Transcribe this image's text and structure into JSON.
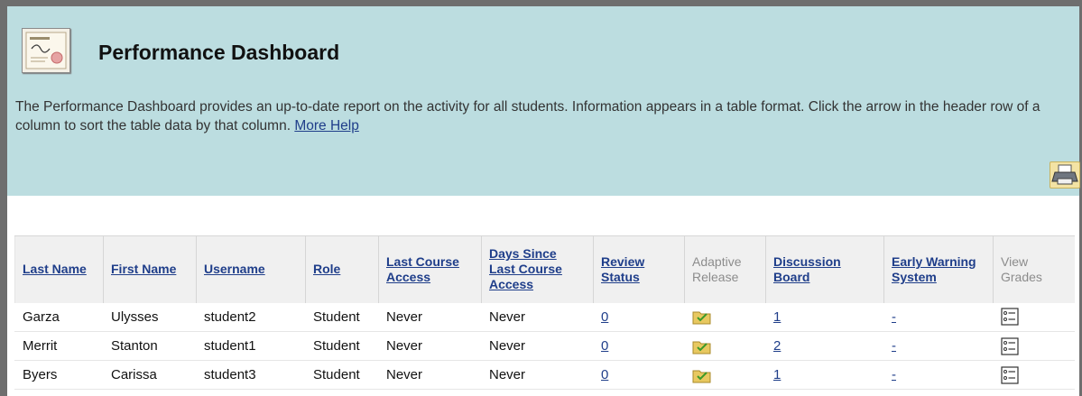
{
  "header": {
    "title": "Performance Dashboard",
    "description": "The Performance Dashboard provides an up-to-date report on the activity for all students. Information appears in a table format. Click the arrow in the header row of a column to sort the table data by that column.",
    "help_link": "More Help",
    "icon": "certificate-icon",
    "print_icon": "printer-icon"
  },
  "table": {
    "columns": [
      {
        "label": "Last Name",
        "sortable": true
      },
      {
        "label": "First Name",
        "sortable": true
      },
      {
        "label": "Username",
        "sortable": true
      },
      {
        "label": "Role",
        "sortable": true
      },
      {
        "label": "Last Course Access",
        "sortable": true
      },
      {
        "label": "Days Since Last Course Access",
        "sortable": true
      },
      {
        "label": "Review Status",
        "sortable": true
      },
      {
        "label": "Adaptive Release",
        "sortable": false
      },
      {
        "label": "Discussion Board",
        "sortable": true
      },
      {
        "label": "Early Warning System",
        "sortable": true
      },
      {
        "label": "View Grades",
        "sortable": false
      }
    ],
    "rows": [
      {
        "last": "Garza",
        "first": "Ulysses",
        "username": "student2",
        "role": "Student",
        "last_access": "Never",
        "days_since": "Never",
        "review": "0",
        "discussion": "1",
        "early_warning": "-"
      },
      {
        "last": "Merrit",
        "first": "Stanton",
        "username": "student1",
        "role": "Student",
        "last_access": "Never",
        "days_since": "Never",
        "review": "0",
        "discussion": "2",
        "early_warning": "-"
      },
      {
        "last": "Byers",
        "first": "Carissa",
        "username": "student3",
        "role": "Student",
        "last_access": "Never",
        "days_since": "Never",
        "review": "0",
        "discussion": "1",
        "early_warning": "-"
      }
    ]
  },
  "colors": {
    "header_bg": "#bcdde0",
    "link": "#1f3e8a",
    "table_header_bg": "#f0f0f0"
  }
}
